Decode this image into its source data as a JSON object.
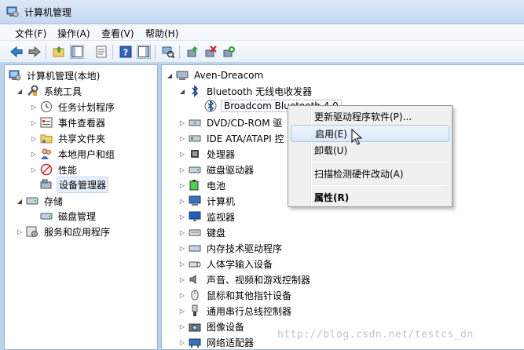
{
  "window": {
    "title": "计算机管理",
    "icon": "computer-management-icon"
  },
  "menu": [
    {
      "label": "文件(F)"
    },
    {
      "label": "操作(A)"
    },
    {
      "label": "查看(V)"
    },
    {
      "label": "帮助(H)"
    }
  ],
  "toolbar": {
    "buttons": [
      "back-arrow-icon",
      "forward-arrow-icon",
      "up-folder-icon",
      "show-hide-tree-icon",
      "properties-icon",
      "help-icon",
      "show-hide-action-pane-icon",
      "scan-hardware-icon",
      "update-driver-icon",
      "uninstall-icon",
      "enable-device-icon"
    ]
  },
  "left_tree": {
    "root": "计算机管理(本地)",
    "system_tools": "系统工具",
    "task_scheduler": "任务计划程序",
    "event_viewer": "事件查看器",
    "shared_folders": "共享文件夹",
    "local_users": "本地用户和组",
    "performance": "性能",
    "device_manager": "设备管理器",
    "storage": "存储",
    "disk_management": "磁盘管理",
    "services_apps": "服务和应用程序"
  },
  "device_tree": {
    "computer": "Aven-Dreacom",
    "bluetooth": "Bluetooth 无线电收发器",
    "broadcom": "Broadcom Bluetooth 4.0",
    "dvd": "DVD/CD-ROM 驱",
    "ide": "IDE ATA/ATAPI 控",
    "processor": "处理器",
    "disk_drives": "磁盘驱动器",
    "battery": "电池",
    "computer_node": "计算机",
    "monitors": "监视器",
    "keyboards": "键盘",
    "memory_tech": "内存技术驱动程序",
    "hid": "人体学输入设备",
    "sound": "声音、视频和游戏控制器",
    "mice": "鼠标和其他指针设备",
    "usb": "通用串行总线控制器",
    "imaging": "图像设备",
    "network": "网络适配器"
  },
  "context_menu": {
    "update_driver": "更新驱动程序软件(P)...",
    "enable": "启用(E)",
    "uninstall": "卸载(U)",
    "scan": "扫描检测硬件改动(A)",
    "properties": "属性(R)"
  },
  "watermark": "http://blog.csdn.net/testcs_dn",
  "colors": {
    "accent": "#3399ff",
    "pane_border": "#99b4d1",
    "hover": "#dce8f8"
  }
}
